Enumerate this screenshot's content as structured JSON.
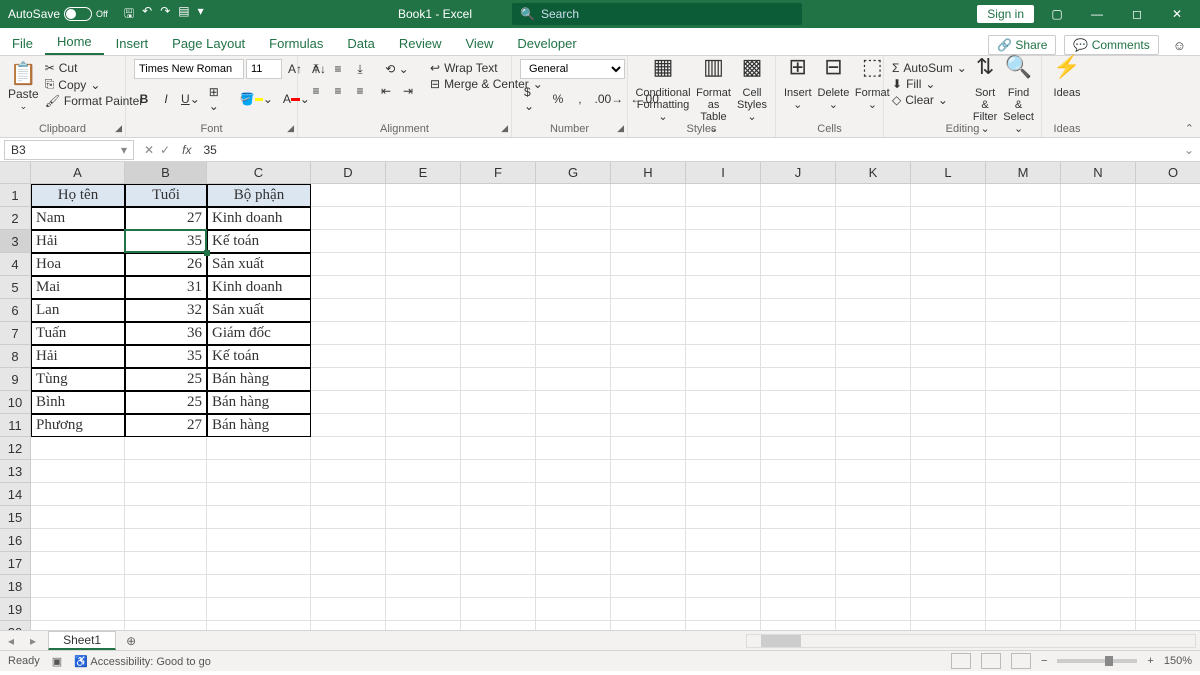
{
  "titlebar": {
    "autosave_label": "AutoSave",
    "autosave_state": "Off",
    "doc_title": "Book1  -  Excel",
    "search_placeholder": "Search",
    "signin": "Sign in"
  },
  "tabs": {
    "file": "File",
    "home": "Home",
    "insert": "Insert",
    "page_layout": "Page Layout",
    "formulas": "Formulas",
    "data": "Data",
    "review": "Review",
    "view": "View",
    "developer": "Developer",
    "share": "Share",
    "comments": "Comments"
  },
  "ribbon": {
    "clipboard": {
      "label": "Clipboard",
      "paste": "Paste",
      "cut": "Cut",
      "copy": "Copy",
      "format_painter": "Format Painter"
    },
    "font": {
      "label": "Font",
      "name": "Times New Roman",
      "size": "11"
    },
    "alignment": {
      "label": "Alignment",
      "wrap": "Wrap Text",
      "merge": "Merge & Center"
    },
    "number": {
      "label": "Number",
      "format": "General"
    },
    "styles": {
      "label": "Styles",
      "cond": "Conditional Formatting",
      "table": "Format as Table",
      "cell": "Cell Styles"
    },
    "cells": {
      "label": "Cells",
      "insert": "Insert",
      "delete": "Delete",
      "format": "Format"
    },
    "editing": {
      "label": "Editing",
      "autosum": "AutoSum",
      "fill": "Fill",
      "clear": "Clear",
      "sort": "Sort & Filter",
      "find": "Find & Select"
    },
    "ideas": {
      "label": "Ideas",
      "ideas": "Ideas"
    }
  },
  "formula_bar": {
    "name_box": "B3",
    "formula": "35"
  },
  "columns": [
    {
      "l": "A",
      "w": 94
    },
    {
      "l": "B",
      "w": 82
    },
    {
      "l": "C",
      "w": 104
    },
    {
      "l": "D",
      "w": 75
    },
    {
      "l": "E",
      "w": 75
    },
    {
      "l": "F",
      "w": 75
    },
    {
      "l": "G",
      "w": 75
    },
    {
      "l": "H",
      "w": 75
    },
    {
      "l": "I",
      "w": 75
    },
    {
      "l": "J",
      "w": 75
    },
    {
      "l": "K",
      "w": 75
    },
    {
      "l": "L",
      "w": 75
    },
    {
      "l": "M",
      "w": 75
    },
    {
      "l": "N",
      "w": 75
    },
    {
      "l": "O",
      "w": 75
    }
  ],
  "data_headers": [
    "Họ tên",
    "Tuổi",
    "Bộ phận"
  ],
  "data_rows": [
    {
      "name": "Nam",
      "age": 27,
      "dept": "Kinh doanh"
    },
    {
      "name": "Hải",
      "age": 35,
      "dept": "Kế toán"
    },
    {
      "name": "Hoa",
      "age": 26,
      "dept": "Sản xuất"
    },
    {
      "name": "Mai",
      "age": 31,
      "dept": "Kinh doanh"
    },
    {
      "name": "Lan",
      "age": 32,
      "dept": "Sản xuất"
    },
    {
      "name": "Tuấn",
      "age": 36,
      "dept": "Giám đốc"
    },
    {
      "name": "Hải",
      "age": 35,
      "dept": "Kế toán"
    },
    {
      "name": "Tùng",
      "age": 25,
      "dept": "Bán hàng"
    },
    {
      "name": "Bình",
      "age": 25,
      "dept": "Bán hàng"
    },
    {
      "name": "Phương",
      "age": 27,
      "dept": "Bán hàng"
    }
  ],
  "total_rows_visible": 20,
  "selected_cell": {
    "row": 3,
    "col": 1
  },
  "sheet_tabs": {
    "active": "Sheet1"
  },
  "statusbar": {
    "ready": "Ready",
    "accessibility": "Accessibility: Good to go",
    "zoom": "150%"
  }
}
